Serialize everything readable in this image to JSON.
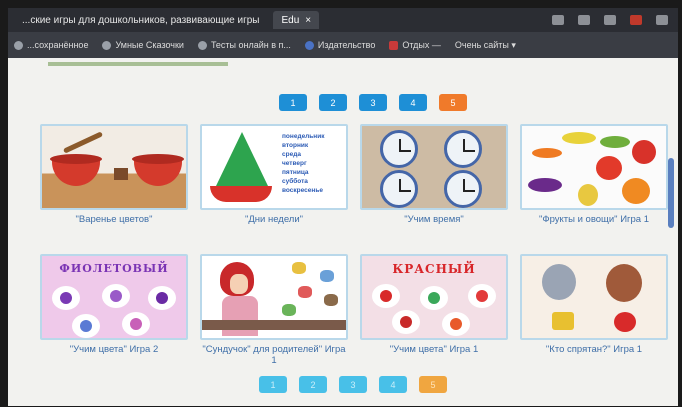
{
  "browser": {
    "tabs": [
      {
        "title": "...ские игры для дошкольников, развивающие игры",
        "active": false
      },
      {
        "title": "Edu",
        "active": true
      }
    ],
    "bookmarks": [
      "...сохранённое",
      "Умные Сказочки",
      "Тесты онлайн в п...",
      "Издательство",
      "Отдых —",
      "Очень сайты ▾"
    ]
  },
  "pagination_top": {
    "pages": [
      "1",
      "2",
      "3",
      "4",
      "5"
    ],
    "current_index": 4
  },
  "games": [
    {
      "caption": "\"Варенье цветов\"",
      "thumb": "berries"
    },
    {
      "caption": "\"Дни недели\"",
      "thumb": "sailboat",
      "words": [
        "понедельник",
        "вторник",
        "среда",
        "четверг",
        "пятница",
        "суббота",
        "воскресенье"
      ]
    },
    {
      "caption": "\"Учим время\"",
      "thumb": "clocks"
    },
    {
      "caption": "\"Фрукты и овощи\" Игра 1",
      "thumb": "fruits"
    },
    {
      "caption": "\"Учим цвета\" Игра 2",
      "thumb": "violet",
      "heading": "ФИОЛЕТОВЫЙ"
    },
    {
      "caption": "\"Сундучок\" для родителей\" Игра 1",
      "thumb": "lady"
    },
    {
      "caption": "\"Учим цвета\" Игра 1",
      "thumb": "red",
      "heading": "КРАСНЫЙ"
    },
    {
      "caption": "\"Кто спрятан?\" Игра 1",
      "thumb": "toys"
    }
  ],
  "pagination_bottom": {
    "pages": [
      "1",
      "2",
      "3",
      "4",
      "5"
    ],
    "current_index": 4
  },
  "colors": {
    "page_button": "#1e8fd6",
    "page_current": "#f07a2a",
    "caption": "#3f6fa8"
  }
}
